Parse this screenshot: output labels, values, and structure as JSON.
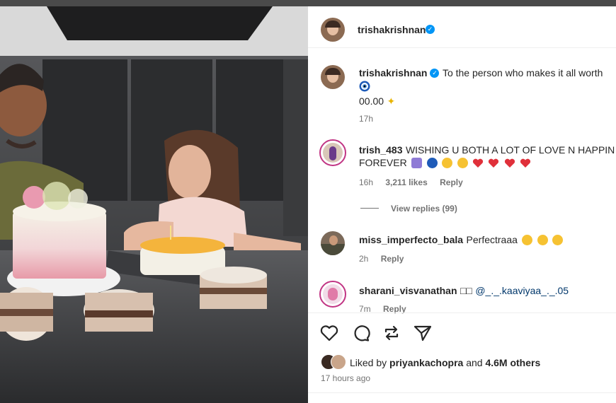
{
  "post": {
    "author": "trishakrishnan",
    "caption_username": "trishakrishnan",
    "caption_text": "To the person who makes it all worth",
    "caption_line2": "00.00",
    "caption_time": "17h"
  },
  "comments": [
    {
      "username": "trish_483",
      "text": "WISHING U BOTH A LOT OF LOVE N HAPPIN",
      "text2": "FOREVER",
      "time": "16h",
      "likes": "3,211 likes",
      "reply": "Reply",
      "view_replies": "View replies (99)"
    },
    {
      "username": "miss_imperfecto_bala",
      "text": "Perfectraaa",
      "time": "2h",
      "reply": "Reply"
    },
    {
      "username": "sharani_visvanathan",
      "text": "□□",
      "mention": "@_._.kaaviyaa_._.05",
      "time": "7m",
      "reply": "Reply"
    }
  ],
  "footer": {
    "liked_by_prefix": "Liked by",
    "liked_by_user": "priyankachopra",
    "liked_by_and": "and",
    "liked_by_count": "4.6M others",
    "timestamp": "17 hours ago"
  },
  "icons": [
    "heart-icon",
    "comment-icon",
    "repost-icon",
    "share-icon",
    "verified-badge-icon"
  ],
  "colors": {
    "accent": "#0095f6",
    "heart": "#e0303a",
    "muted": "#737373",
    "story_ring": "#c13584",
    "mention": "#00376b"
  }
}
